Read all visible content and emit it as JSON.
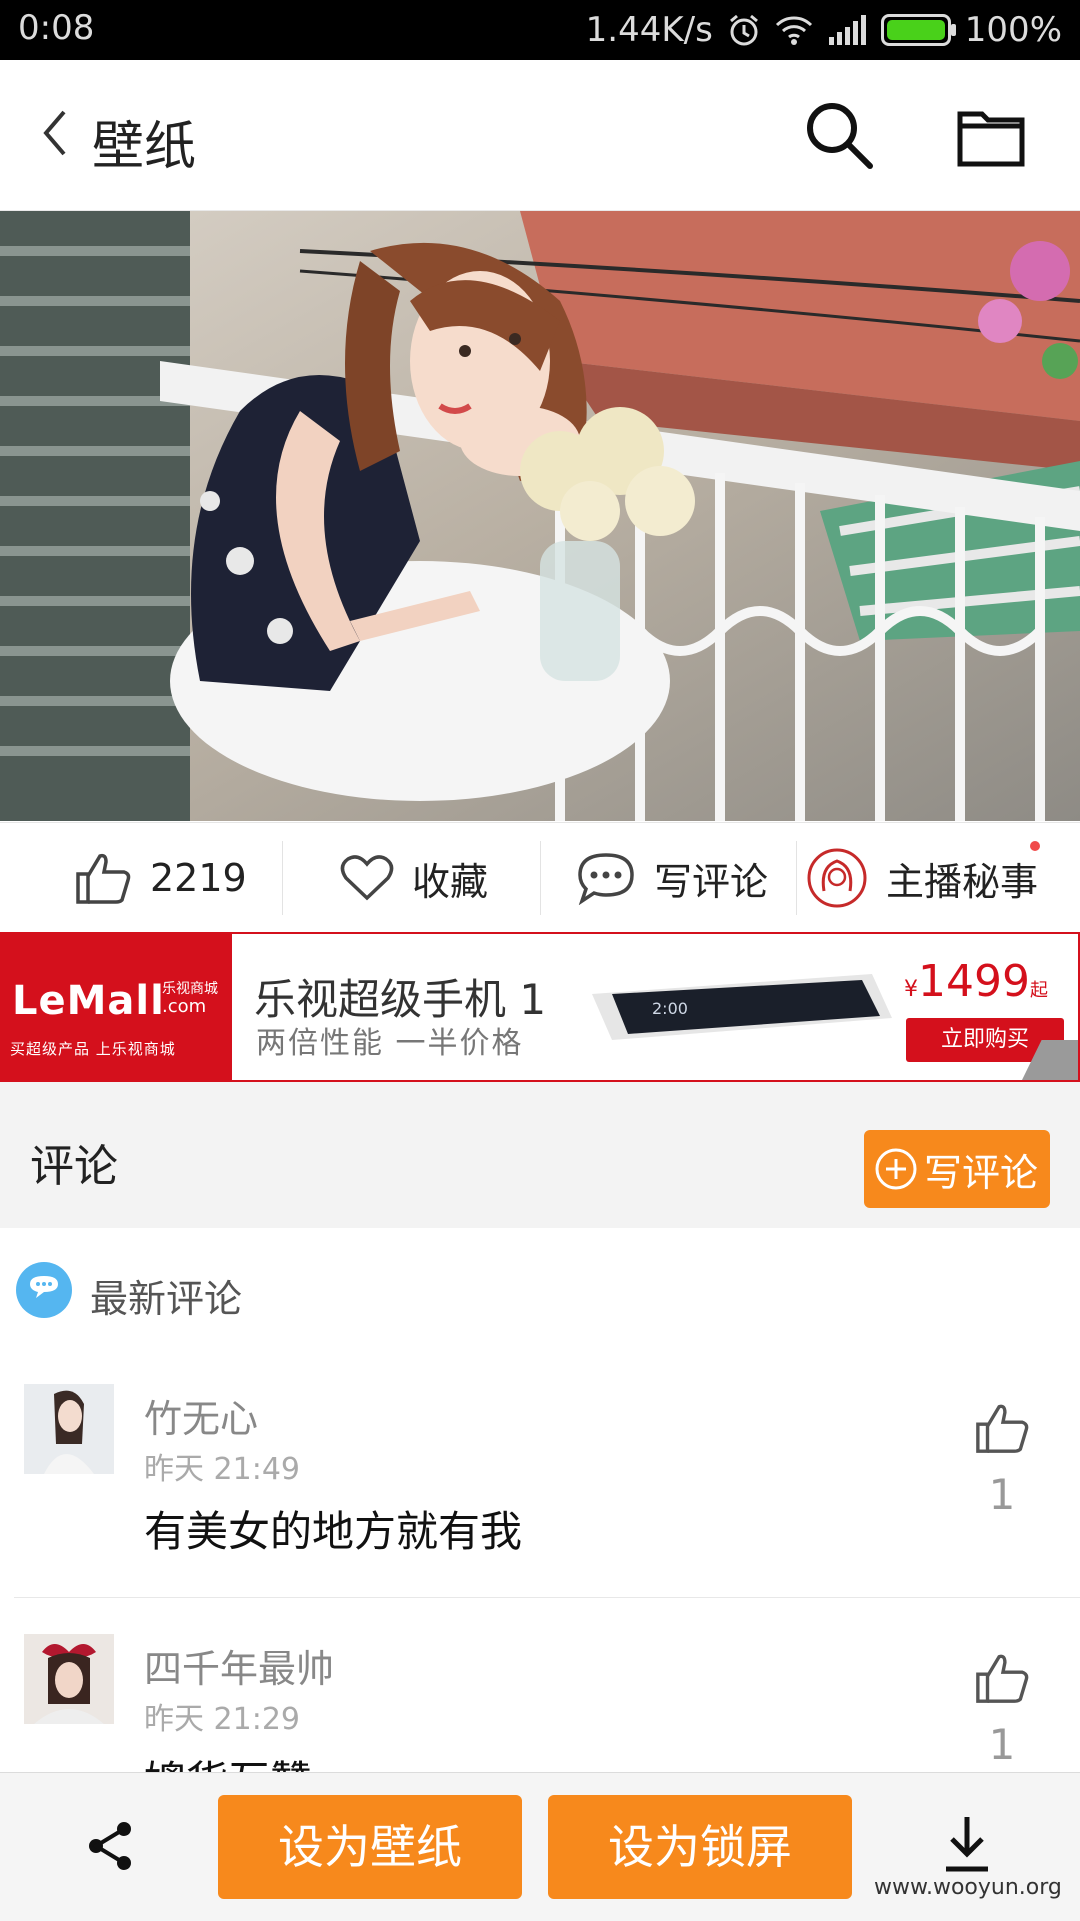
{
  "status_bar": {
    "time": "0:08",
    "network_speed": "1.44K/s",
    "battery": "100%",
    "icons": [
      "alarm-icon",
      "wifi-icon",
      "signal-icon",
      "battery-icon"
    ]
  },
  "header": {
    "title": "壁纸",
    "icons": [
      "back-icon",
      "search-icon",
      "folder-icon"
    ]
  },
  "actions": {
    "like_count": "2219",
    "favorite_label": "收藏",
    "comment_label": "写评论",
    "anchor_label": "主播秘事"
  },
  "ad": {
    "brand_logo": "LeMall",
    "brand_cn": "乐视商城",
    "brand_com": ".com",
    "brand_tagline": "买超级产品 上乐视商城",
    "headline": "乐视超级手机 1",
    "subline": "两倍性能 一半价格",
    "currency": "¥",
    "price": "1499",
    "price_suffix": "起",
    "buy_label": "立即购买",
    "phone_screen_text": "2:00"
  },
  "comments": {
    "section_title": "评论",
    "write_button": "写评论",
    "latest_label": "最新评论",
    "items": [
      {
        "user": "竹无心",
        "time": "昨天 21:49",
        "text": "有美女的地方就有我",
        "likes": "1"
      },
      {
        "user": "四千年最帅",
        "time": "昨天 21:29",
        "text": "媲货互赞",
        "likes": "1"
      }
    ]
  },
  "bottom_bar": {
    "set_wallpaper": "设为壁纸",
    "set_lockscreen": "设为锁屏",
    "watermark": "www.wooyun.org"
  },
  "colors": {
    "accent_orange": "#f7891c",
    "ad_red": "#d4101c",
    "battery_green": "#49d11a"
  }
}
